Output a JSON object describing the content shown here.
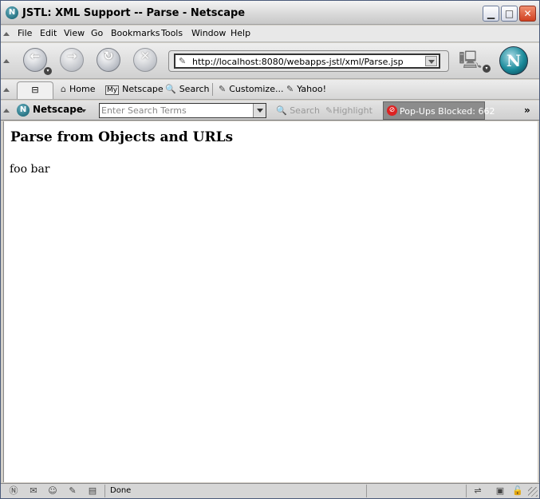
{
  "window": {
    "title": "JSTL: XML Support -- Parse - Netscape",
    "app_icon_glyph": "N",
    "minimize_glyph": "▁",
    "maximize_glyph": "□",
    "close_glyph": "✕"
  },
  "menu": [
    "File",
    "Edit",
    "View",
    "Go",
    "Bookmarks",
    "Tools",
    "Window",
    "Help"
  ],
  "nav": {
    "back_glyph": "←",
    "forward_glyph": "→",
    "reload_glyph": "↻",
    "stop_glyph": "✕",
    "dropdown_glyph": "▾",
    "url": "http://localhost:8080/webapps-jstl/xml/Parse.jsp",
    "throbber_glyph": "N"
  },
  "personal_toolbar": {
    "sidebar_glyph": "⊟",
    "items": [
      {
        "label": "Home",
        "icon": "home-icon",
        "glyph": "⌂"
      },
      {
        "label": "Netscape",
        "icon": "my-netscape-icon",
        "glyph": "My"
      },
      {
        "label": "Search",
        "icon": "search-icon",
        "glyph": "🔍"
      },
      {
        "label": "Customize...",
        "icon": "bookmark-icon",
        "glyph": "✎"
      },
      {
        "label": "Yahoo!",
        "icon": "bookmark-icon",
        "glyph": "✎"
      }
    ]
  },
  "search_toolbar": {
    "brand_label": "Netscape",
    "search_placeholder": "Enter Search Terms",
    "search_button": "Search",
    "highlight_button": "Highlight",
    "popups_blocked": "Pop-Ups Blocked: 662",
    "overflow_glyph": "»"
  },
  "page": {
    "heading": "Parse from Objects and URLs",
    "body": "foo bar"
  },
  "status": {
    "text": "Done"
  },
  "colors": {
    "close_button": "#d04020",
    "throbber": "#1a8a9a",
    "popup_blocked_bg": "#8c8c8c"
  }
}
